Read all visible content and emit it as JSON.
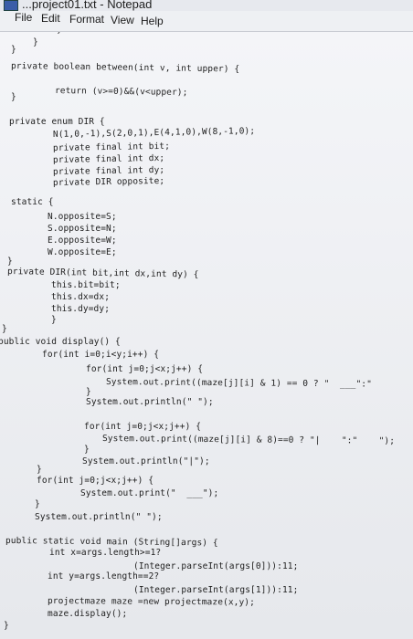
{
  "window": {
    "title": "...project01.txt - Notepad"
  },
  "menu": {
    "file": "File",
    "edit": "Edit",
    "format": "Format",
    "view": "View",
    "help": "Help"
  },
  "editor": {
    "lines": [
      "}",
      "}",
      "}",
      "private boolean between(int v, int upper) {",
      "return (v>=0)&&(v<upper);",
      "}",
      "private enum DIR {",
      "N(1,0,-1),S(2,0,1),E(4,1,0),W(8,-1,0);",
      "private final int bit;",
      "private final int dx;",
      "private final int dy;",
      "private DIR opposite;",
      "static {",
      "N.opposite=S;",
      "S.opposite=N;",
      "E.opposite=W;",
      "W.opposite=E;",
      "}",
      "private DIR(int bit,int dx,int dy) {",
      "this.bit=bit;",
      "this.dx=dx;",
      "this.dy=dy;",
      "}",
      "}",
      "public void display() {",
      "for(int i=0;i<y;i++) {",
      "for(int j=0;j<x;j++) {",
      "System.out.print((maze[j][i] & 1) == 0 ? \"  ___\":\"",
      "}",
      "System.out.println(\" \");",
      "for(int j=0;j<x;j++) {",
      "System.out.print((maze[j][i] & 8)==0 ? \"|    \":\"    \");",
      "}",
      "System.out.println(\"|\");",
      "}",
      "for(int j=0;j<x;j++) {",
      "System.out.print(\"  ___\");",
      "}",
      "System.out.println(\" \");",
      "public static void main (String[]args) {",
      "int x=args.length>=1?",
      "(Integer.parseInt(args[0])):11;",
      "int y=args.length==2?",
      "(Integer.parseInt(args[1])):11;",
      "projectmaze maze =new projectmaze(x,y);",
      "maze.display();",
      "}"
    ]
  }
}
